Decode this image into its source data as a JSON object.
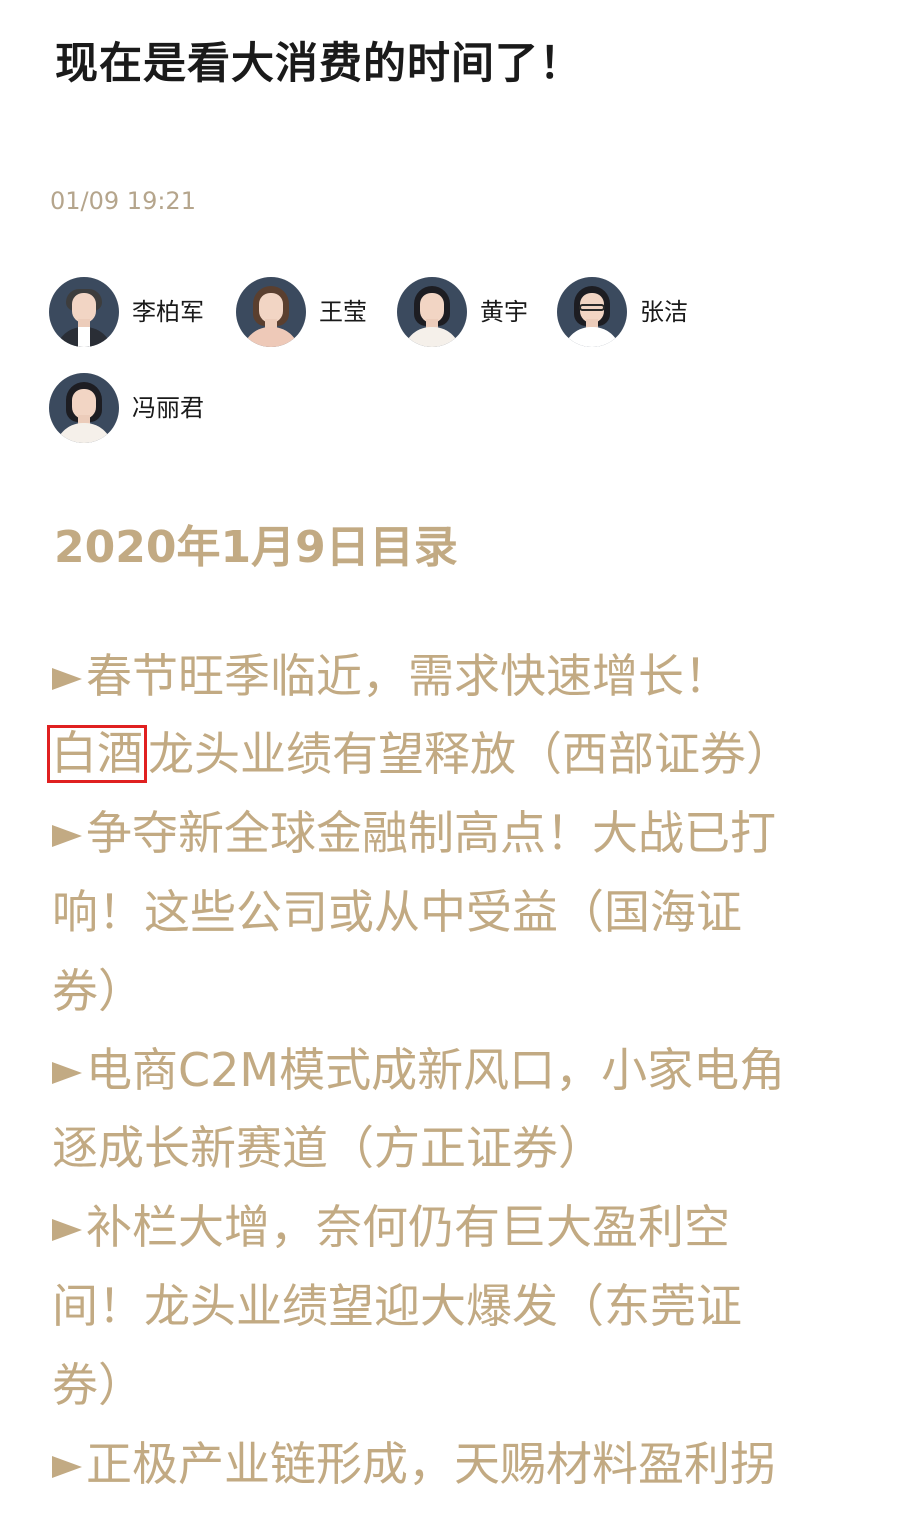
{
  "article": {
    "title": "现在是看大消费的时间了！",
    "timestamp": "01/09 19:21"
  },
  "authors": [
    {
      "name": "李柏军",
      "avatar_icon": "person-portrait-icon"
    },
    {
      "name": "王莹",
      "avatar_icon": "person-portrait-icon"
    },
    {
      "name": "黄宇",
      "avatar_icon": "person-portrait-icon"
    },
    {
      "name": "张洁",
      "avatar_icon": "person-portrait-icon"
    },
    {
      "name": "冯丽君",
      "avatar_icon": "person-portrait-icon"
    }
  ],
  "toc": {
    "heading": "2020年1月9日目录",
    "bullet_icon": "triangle-right-icon",
    "highlight_color": "#e02020",
    "text_color": "#c2aa83",
    "lines": {
      "l1": "春节旺季临近，需求快速增长！",
      "l2_highlight": "白酒",
      "l2_rest": "龙头业绩有望释放（西部证券）",
      "l3": "争夺新全球金融制高点！大战已打",
      "l4": "响！这些公司或从中受益（国海证",
      "l5": "券）",
      "l6": "电商C2M模式成新风口，小家电角",
      "l7": "逐成长新赛道（方正证券）",
      "l8": "补栏大增，奈何仍有巨大盈利空",
      "l9": "间！龙头业绩望迎大爆发（东莞证",
      "l10": "券）",
      "l11": "正极产业链形成，天赐材料盈利拐"
    }
  }
}
